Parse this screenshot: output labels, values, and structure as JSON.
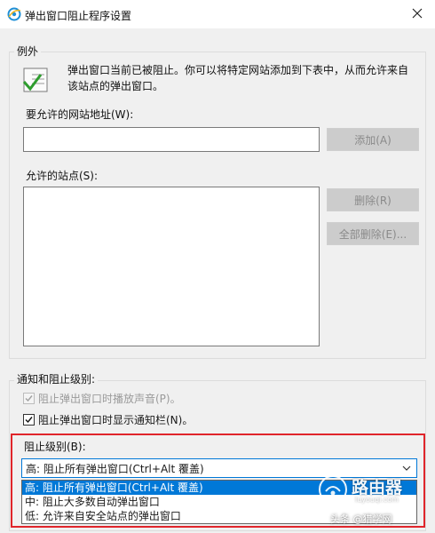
{
  "window": {
    "title": "弹出窗口阻止程序设置"
  },
  "exceptions": {
    "group_label": "例外",
    "description_line1": "弹出窗口当前已被阻止。你可以将特定网站添加到下表中，从而允许来自",
    "description_line2": "该站点的弹出窗口。",
    "address_label": "要允许的网站地址(W):",
    "address_value": "",
    "add_button": "添加(A)",
    "allowed_sites_label": "允许的站点(S):",
    "allowed_sites": [],
    "remove_button": "删除(R)",
    "remove_all_button": "全部删除(E)..."
  },
  "notifications": {
    "group_label": "通知和阻止级别:",
    "play_sound": {
      "label": "阻止弹出窗口时播放声音(P)。",
      "checked": true,
      "enabled": false
    },
    "show_bar": {
      "label": "阻止弹出窗口时显示通知栏(N)。",
      "checked": true,
      "enabled": true
    },
    "level_label": "阻止级别(B):",
    "level_selected": "高: 阻止所有弹出窗口(Ctrl+Alt 覆盖)",
    "level_options": [
      "高: 阻止所有弹出窗口(Ctrl+Alt 覆盖)",
      "中: 阻止大多数自动弹出窗口",
      "低: 允许来自安全站点的弹出窗口"
    ]
  },
  "watermark": {
    "text1": "路由器",
    "text2": "luyouqi.com",
    "text3": "头条 @猎学网"
  },
  "colors": {
    "accent": "#0078d7",
    "highlight_box": "#e0252b"
  }
}
